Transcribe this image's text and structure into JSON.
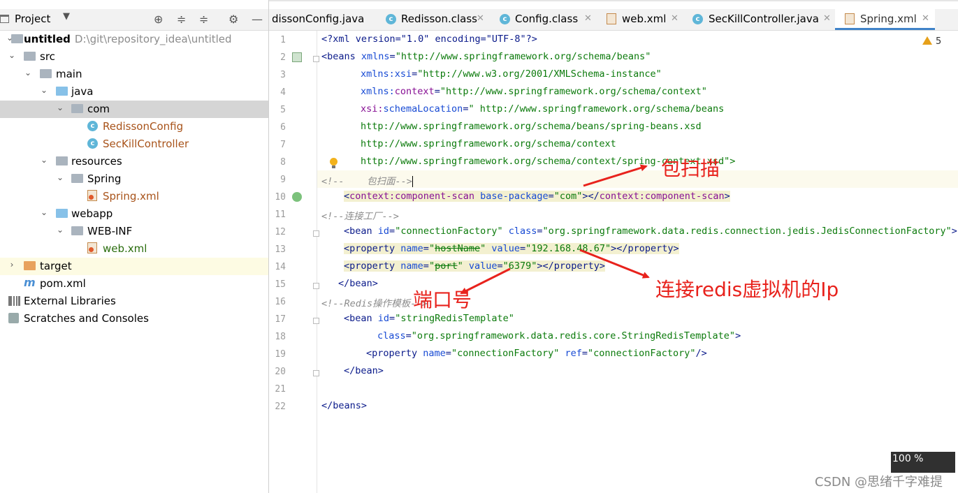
{
  "project_panel": {
    "title": "Project",
    "tree": [
      {
        "label": "untitled",
        "path": "D:\\git\\repository_idea\\untitled"
      },
      {
        "label": "src"
      },
      {
        "label": "main"
      },
      {
        "label": "java"
      },
      {
        "label": "com"
      },
      {
        "label": "RedissonConfig"
      },
      {
        "label": "SecKillController"
      },
      {
        "label": "resources"
      },
      {
        "label": "Spring"
      },
      {
        "label": "Spring.xml"
      },
      {
        "label": "webapp"
      },
      {
        "label": "WEB-INF"
      },
      {
        "label": "web.xml"
      },
      {
        "label": "target"
      },
      {
        "label": "pom.xml"
      },
      {
        "label": "External Libraries"
      },
      {
        "label": "Scratches and Consoles"
      }
    ]
  },
  "tabs": [
    {
      "label": "dissonConfig.java"
    },
    {
      "label": "Redisson.class"
    },
    {
      "label": "Config.class"
    },
    {
      "label": "web.xml"
    },
    {
      "label": "SecKillController.java"
    },
    {
      "label": "Spring.xml"
    }
  ],
  "editor": {
    "line_numbers": [
      "1",
      "2",
      "3",
      "4",
      "5",
      "6",
      "7",
      "8",
      "9",
      "10",
      "11",
      "12",
      "13",
      "14",
      "15",
      "16",
      "17",
      "18",
      "19",
      "20",
      "21",
      "22"
    ],
    "lines": {
      "l1": [
        "<?xml version=\"1.0\" encoding=\"UTF-8\"?>"
      ],
      "l2": [
        "<beans ",
        "xmlns",
        "=",
        "\"http://www.springframework.org/schema/beans\""
      ],
      "l3": [
        "xmlns:xsi",
        "=",
        "\"http://www.w3.org/2001/XMLSchema-instance\""
      ],
      "l4": [
        "xmlns:",
        "context",
        "=",
        "\"http://www.springframework.org/schema/context\""
      ],
      "l5": [
        "xsi:",
        "schemaLocation",
        "=",
        "\" http://www.springframework.org/schema/beans"
      ],
      "l6": [
        "http://www.springframework.org/schema/beans/spring-beans.xsd"
      ],
      "l7": [
        "http://www.springframework.org/schema/context"
      ],
      "l8": [
        "http://www.springframework.org/schema/context/spring-context.xsd\">"
      ],
      "l9": [
        "<!--    包扫面-->"
      ],
      "l10": [
        "<",
        "context:component-scan ",
        "base-package",
        "=",
        "\"com\"",
        "></",
        "context:component-scan",
        ">"
      ],
      "l11": [
        "<!--连接工厂-->"
      ],
      "l12": [
        "<bean ",
        "id",
        "=",
        "\"connectionFactory\" ",
        "class",
        "=",
        "\"org.springframework.data.redis.connection.jedis.JedisConnectionFactory\"",
        ">"
      ],
      "l13": [
        "<property ",
        "name",
        "=",
        "\"",
        "hostName",
        "\" ",
        "value",
        "=",
        "\"192.168.48.67\"",
        "></property>"
      ],
      "l14": [
        "<property ",
        "name",
        "=",
        "\"",
        "port",
        "\" ",
        "value",
        "=",
        "\"6379\"",
        "></property>"
      ],
      "l15": [
        "</bean>"
      ],
      "l16": [
        "<!--Redis操作模板-->"
      ],
      "l17": [
        "<bean ",
        "id",
        "=",
        "\"stringRedisTemplate\""
      ],
      "l18": [
        "class",
        "=",
        "\"org.springframework.data.redis.core.StringRedisTemplate\"",
        ">"
      ],
      "l19": [
        "<property ",
        "name",
        "=",
        "\"connectionFactory\" ",
        "ref",
        "=",
        "\"connectionFactory\"",
        "/>"
      ],
      "l20": [
        "</bean>"
      ],
      "l22": [
        "</beans>"
      ]
    }
  },
  "annotations": {
    "package_scan": "包扫描",
    "redis_ip": "连接redis虚拟机的Ip",
    "port": "端口号"
  },
  "warnings": {
    "count": "5"
  },
  "zoom": "100 %",
  "watermark": "CSDN @思绪千字难提",
  "colors": {
    "accent": "#4083c9",
    "annotation": "#e8221c",
    "selection": "#d5d5d5"
  }
}
